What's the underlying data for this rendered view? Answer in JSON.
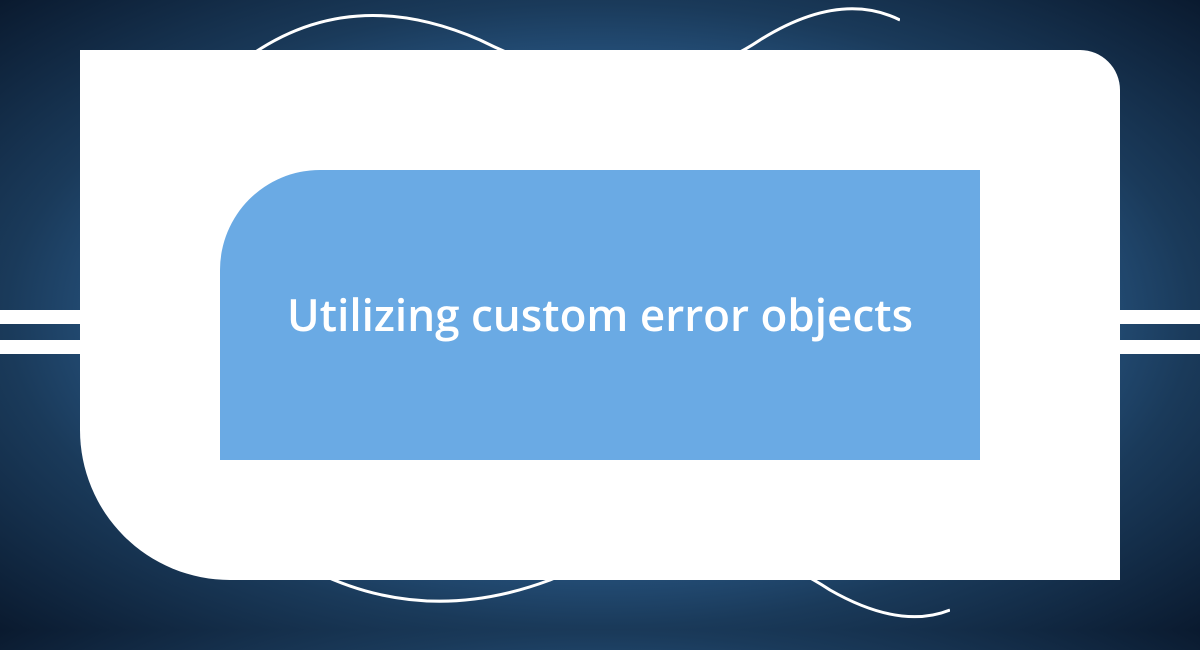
{
  "card": {
    "title": "Utilizing custom error objects"
  },
  "colors": {
    "inner_bg": "#6aaae4",
    "outer_bg": "#ffffff",
    "text": "#ffffff"
  }
}
